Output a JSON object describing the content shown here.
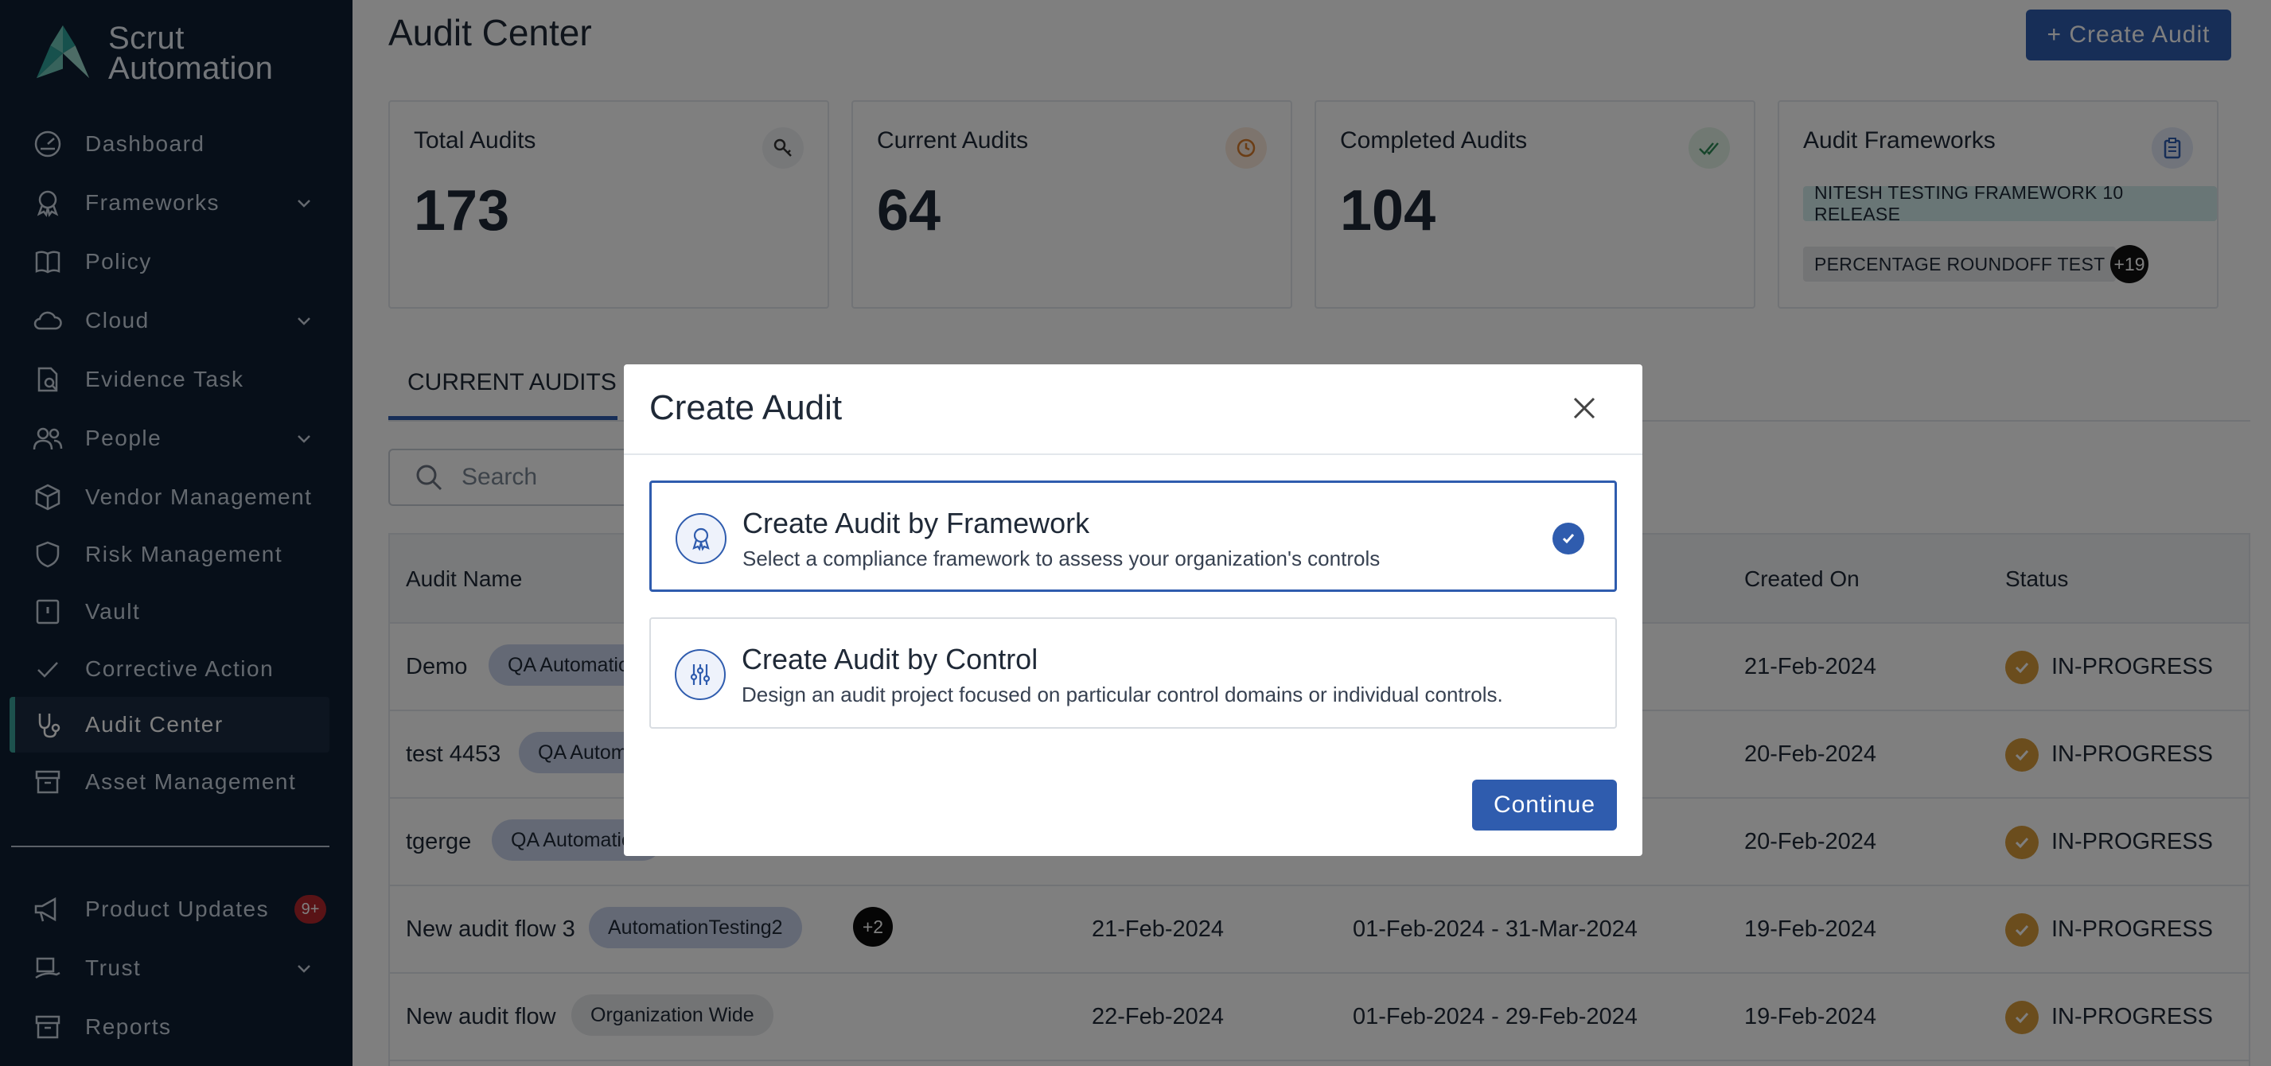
{
  "app": {
    "logo_line1": "Scrut",
    "logo_line2": "Automation"
  },
  "sidebar": {
    "items": [
      {
        "label": "Dashboard",
        "icon": "dashboard-icon",
        "has_chevron": false,
        "active": false
      },
      {
        "label": "Frameworks",
        "icon": "award-icon",
        "has_chevron": true,
        "active": false
      },
      {
        "label": "Policy",
        "icon": "book-icon",
        "has_chevron": false,
        "active": false
      },
      {
        "label": "Cloud",
        "icon": "cloud-icon",
        "has_chevron": true,
        "active": false
      },
      {
        "label": "Evidence Task",
        "icon": "document-search-icon",
        "has_chevron": false,
        "active": false
      },
      {
        "label": "People",
        "icon": "people-icon",
        "has_chevron": true,
        "active": false
      },
      {
        "label": "Vendor Management",
        "icon": "box-icon",
        "has_chevron": false,
        "active": false
      },
      {
        "label": "Risk Management",
        "icon": "shield-icon",
        "has_chevron": false,
        "active": false
      },
      {
        "label": "Vault",
        "icon": "vault-icon",
        "has_chevron": false,
        "active": false
      },
      {
        "label": "Corrective Action",
        "icon": "check-icon",
        "has_chevron": false,
        "active": false
      },
      {
        "label": "Audit Center",
        "icon": "stethoscope-icon",
        "has_chevron": false,
        "active": true
      },
      {
        "label": "Asset Management",
        "icon": "archive-icon",
        "has_chevron": false,
        "active": false
      }
    ],
    "bottom_items": [
      {
        "label": "Product Updates",
        "icon": "megaphone-icon",
        "badge": "9+"
      },
      {
        "label": "Trust",
        "icon": "trust-icon",
        "has_chevron": true
      },
      {
        "label": "Reports",
        "icon": "reports-icon"
      }
    ]
  },
  "header": {
    "title": "Audit Center",
    "create_button": "+ Create Audit"
  },
  "stats": [
    {
      "title": "Total Audits",
      "value": "173",
      "icon": "key-search-icon"
    },
    {
      "title": "Current Audits",
      "value": "64",
      "icon": "clock-icon"
    },
    {
      "title": "Completed Audits",
      "value": "104",
      "icon": "double-check-icon"
    },
    {
      "title": "Audit Frameworks",
      "icon": "clipboard-icon",
      "tags": [
        "NITESH TESTING FRAMEWORK 10 RELEASE",
        "PERCENTAGE ROUNDOFF TEST"
      ],
      "more": "+19"
    }
  ],
  "tabs": {
    "current": "CURRENT AUDITS"
  },
  "search": {
    "placeholder": "Search"
  },
  "table": {
    "headers": {
      "audit_name": "Audit Name",
      "created_on": "Created On",
      "status": "Status"
    },
    "rows": [
      {
        "name": "Demo",
        "tag": "QA Automation",
        "created": "21-Feb-2024",
        "status": "IN-PROGRESS"
      },
      {
        "name": "test 4453",
        "tag": "QA Automation",
        "created": "20-Feb-2024",
        "status": "IN-PROGRESS"
      },
      {
        "name": "tgerge",
        "tag": "QA Automation",
        "created": "20-Feb-2024",
        "status": "IN-PROGRESS"
      },
      {
        "name": "New audit flow 3",
        "tag": "AutomationTesting2",
        "more": "+2",
        "due": "21-Feb-2024",
        "period": "01-Feb-2024 - 31-Mar-2024",
        "created": "19-Feb-2024",
        "status": "IN-PROGRESS"
      },
      {
        "name": "New audit flow",
        "tag": "Organization Wide",
        "due": "22-Feb-2024",
        "period": "01-Feb-2024 - 29-Feb-2024",
        "created": "19-Feb-2024",
        "status": "IN-PROGRESS"
      }
    ]
  },
  "modal": {
    "title": "Create Audit",
    "options": [
      {
        "title": "Create Audit by Framework",
        "description": "Select a compliance framework to assess your organization's controls",
        "selected": true
      },
      {
        "title": "Create Audit by Control",
        "description": "Design an audit project focused on particular control domains or individual controls.",
        "selected": false
      }
    ],
    "continue": "Continue"
  },
  "colors": {
    "sidebar_bg": "#0f1f33",
    "accent": "#2f5cae",
    "active_marker": "#3aa39a",
    "status_in_progress": "#d79a3a"
  }
}
